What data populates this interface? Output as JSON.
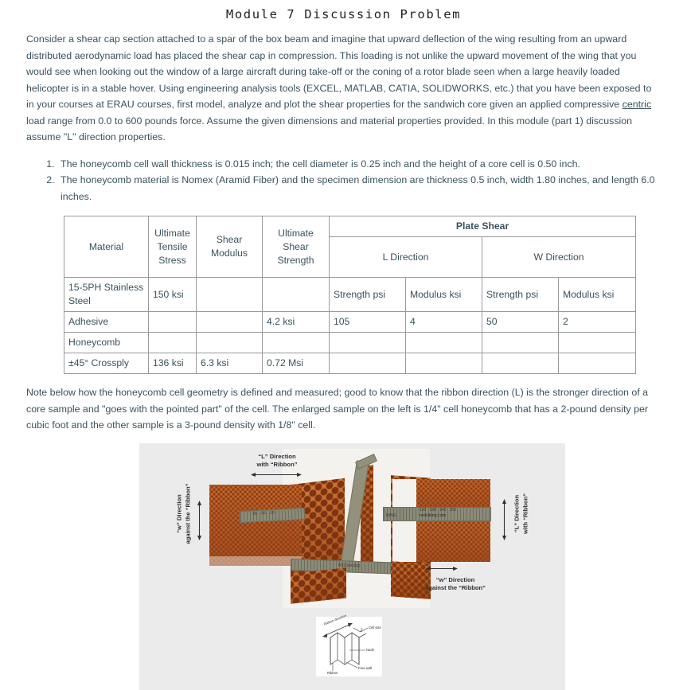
{
  "document": {
    "title": "Module 7 Discussion Problem",
    "intro_paragraph": "Consider a shear cap section attached to a spar of the box beam and imagine that upward deflection of the wing resulting from an upward distributed aerodynamic load has placed the shear cap in compression. This loading is not unlike the upward movement of the wing that you would see when looking out the window of a large aircraft during take-off or the coning of a rotor blade seen when a large heavily loaded helicopter is in a stable hover. Using engineering analysis tools (EXCEL, MATLAB, CATIA, SOLIDWORKS, etc.) that you have been exposed to in your courses at ERAU courses, first model, analyze and plot the shear properties for the sandwich core given an applied compressive ",
    "intro_underlined_word": "centric",
    "intro_paragraph_end": " load range from 0.0 to 600 pounds force. Assume the given dimensions and material properties provided. In this module (part 1) discussion assume \"L\" direction properties.",
    "spec_items": [
      "The honeycomb cell wall thickness is 0.015 inch; the cell diameter is 0.25 inch and the height of a core cell is 0.50 inch.",
      "The honeycomb material is Nomex (Aramid Fiber) and the specimen dimension are thickness 0.5 inch, width 1.80 inches, and length 6.0 inches."
    ],
    "note_paragraph": "Note below how the honeycomb cell geometry is defined and measured; good to know that the ribbon direction (L) is the stronger direction of a core sample and \"goes with the pointed part\" of the cell. The enlarged sample on the left is 1/4\" cell honeycomb that has a 2-pound density per cubic foot and the other sample is a 3-pound density with 1/8\" cell."
  },
  "table": {
    "headers": {
      "material": "Material",
      "ultimate_tensile_stress": "Ultimate Tensile Stress",
      "shear_modulus": "Shear Modulus",
      "ultimate_shear_strength": "Ultimate Shear Strength",
      "plate_shear": "Plate Shear",
      "l_direction": "L Direction",
      "w_direction": "W Direction",
      "l_strength": "Strength psi",
      "l_modulus": "Modulus ksi",
      "w_strength": "Strength psi",
      "w_modulus": "Modulus ksi"
    },
    "rows": [
      {
        "material": "15-5PH Stainless Steel",
        "ultimate_tensile_stress": "150 ksi",
        "shear_modulus": "",
        "ultimate_shear_strength": ""
      },
      {
        "material": "Adhesive",
        "ultimate_tensile_stress": "",
        "shear_modulus": "",
        "ultimate_shear_strength": "4.2 ksi"
      },
      {
        "material": "Honeycomb",
        "ultimate_tensile_stress": "",
        "shear_modulus": "",
        "ultimate_shear_strength": "",
        "l_strength": "105",
        "l_modulus": "4",
        "w_strength": "50",
        "w_modulus": "2"
      },
      {
        "material": "±45° Crossply",
        "ultimate_tensile_stress": "136 ksi",
        "shear_modulus": "6.3 ksi",
        "ultimate_shear_strength": "0.72 Msi",
        "l_strength": "",
        "l_modulus": "",
        "w_strength": "",
        "w_modulus": ""
      }
    ]
  },
  "figure": {
    "background_color": "#ebebeb",
    "label_left_l": "“L” Direction\nwith “Ribbon”",
    "label_left_l_line1": "“L” Direction",
    "label_left_l_line2": "with “Ribbon”",
    "label_left_w_line1": "“w” Direction",
    "label_left_w_line2": "against the “Ribbon”",
    "label_right_l_line1": "“L” Direction",
    "label_right_l_line2": "with “Ribbon”",
    "label_right_w_line1": "“w” Direction",
    "label_right_w_line2": "against the “Ribbon”",
    "ruler_brand": "redviking.com",
    "ruler_brand_2": "REDVIKING",
    "ruler_marks_right": [
      "120",
      "130",
      "140",
      "150"
    ],
    "ruler_marks_left": [
      "30",
      "20",
      "10"
    ],
    "ruler_ring_text": "RING",
    "diagram_labels": {
      "ribbon_direction": "Ribbon direction",
      "cell_size": "Cell size",
      "node": "Node",
      "free_wall": "Free wall",
      "ribbon": "Ribbon"
    }
  }
}
